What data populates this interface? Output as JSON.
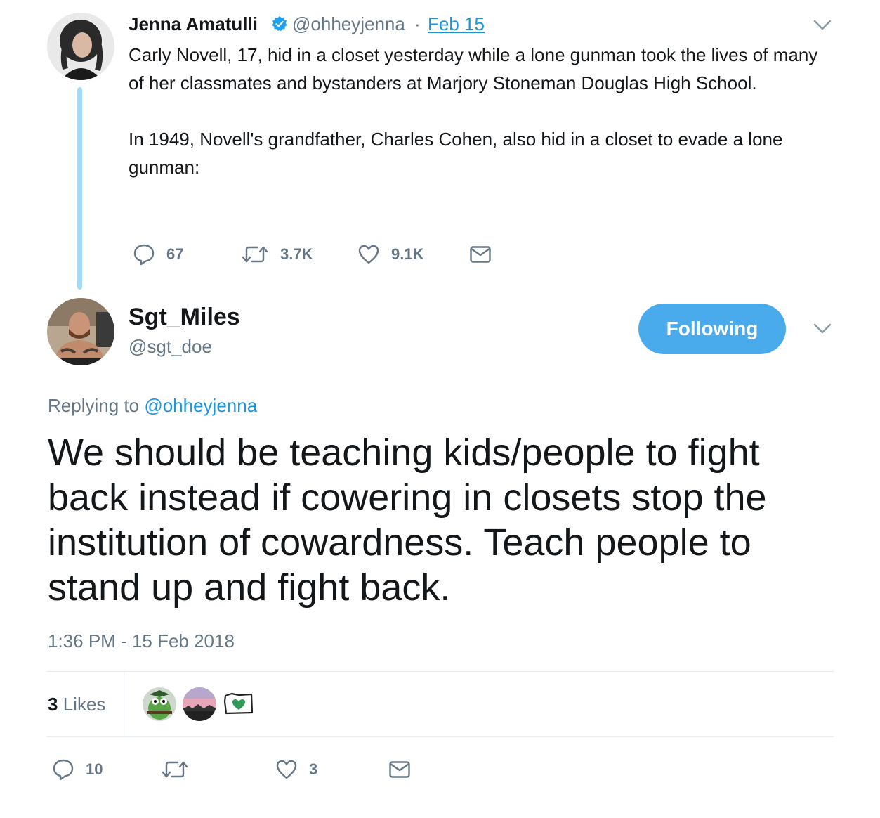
{
  "parent_tweet": {
    "author_name": "Jenna Amatulli",
    "handle": "@ohheyjenna",
    "separator": "·",
    "date": "Feb 15",
    "paragraphs": [
      "Carly Novell, 17, hid in a closet yesterday while a lone gunman took the lives of many of her classmates and bystanders at Marjory Stoneman Douglas High School.",
      "In 1949, Novell's grandfather, Charles Cohen, also hid in a closet to evade a lone gunman:"
    ],
    "replies": "67",
    "retweets": "3.7K",
    "likes": "9.1K",
    "verified_icon": "verified-badge-icon",
    "verified_color": "#1da1f2"
  },
  "main_tweet": {
    "author_name": "Sgt_Miles",
    "handle": "@sgt_doe",
    "follow_label": "Following",
    "replying_prefix": "Replying to",
    "replying_to": "@ohheyjenna",
    "text": "We should be teaching kids/people to fight back instead if cowering in closets stop the institution of cowardness. Teach people to stand up and fight back.",
    "timestamp": "1:36 PM - 15 Feb 2018",
    "likes_count": "3",
    "likes_label": "Likes",
    "replies": "10",
    "retweets": "",
    "likes": "3"
  },
  "colors": {
    "accent": "#1b95e0",
    "follow_button": "#4aabec",
    "muted": "#657786",
    "thread_line": "#a4d9f7"
  }
}
